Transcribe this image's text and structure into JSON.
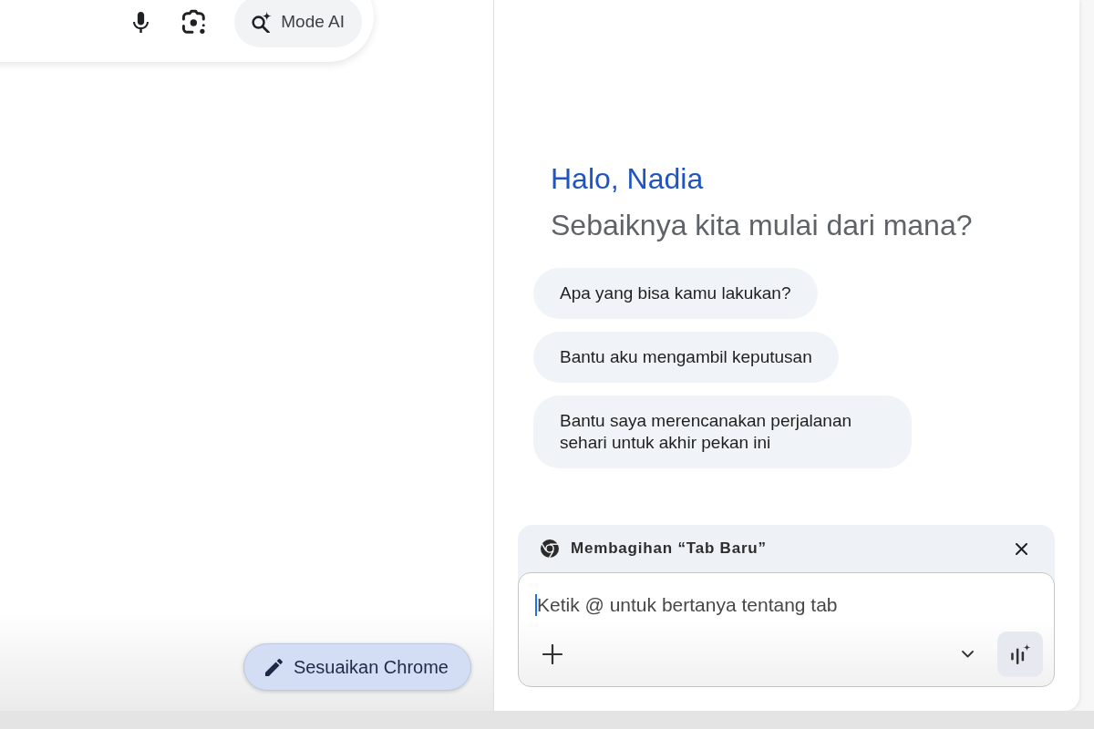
{
  "search_bar": {
    "mode_button": {
      "label": "Mode AI"
    }
  },
  "customize_button": {
    "label": "Sesuaikan Chrome"
  },
  "side_panel": {
    "greeting": "Halo, Nadia",
    "question": "Sebaiknya kita mulai dari mana?",
    "suggestions": [
      "Apa yang bisa kamu lakukan?",
      "Bantu aku mengambil keputusan",
      "Bantu saya merencanakan perjalanan sehari untuk akhir pekan ini"
    ],
    "tab_sharing": {
      "label": "Membagihan “Tab Baru”"
    },
    "composer": {
      "placeholder": "Ketik @ untuk bertanya tentang tab"
    }
  }
}
